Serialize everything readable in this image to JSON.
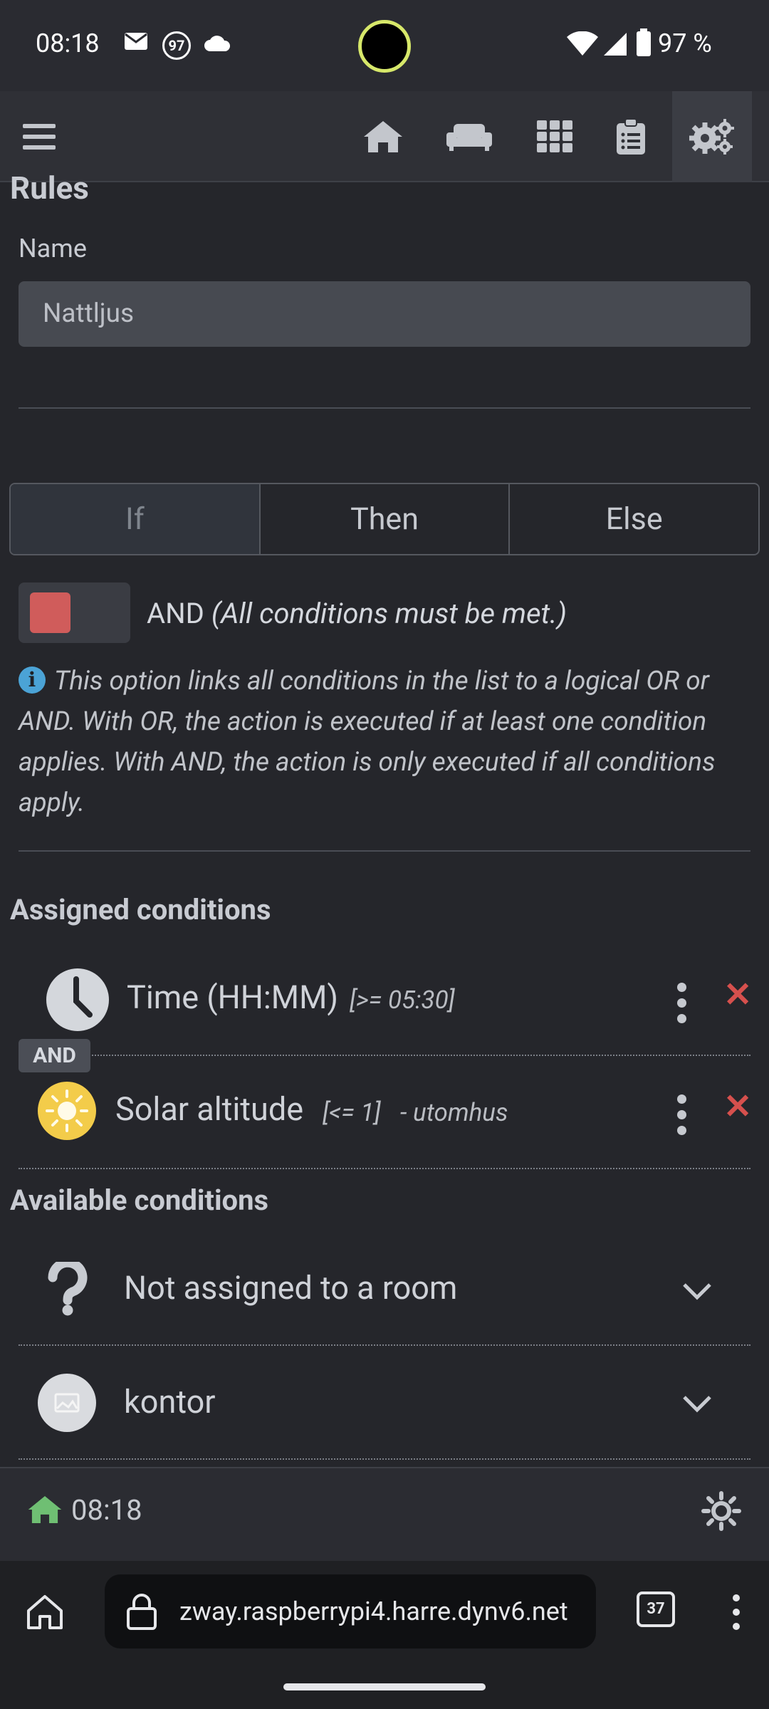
{
  "status_bar": {
    "time": "08:18",
    "notif_badge": "97",
    "battery": "97 %"
  },
  "nav": {
    "items": [
      "menu-icon",
      "home-icon",
      "sofa-icon",
      "grid-icon",
      "clipboard-icon",
      "settings-icon"
    ],
    "active": "settings-icon"
  },
  "page": {
    "title": "Rules",
    "name_label": "Name",
    "name_value": "Nattljus"
  },
  "tabs": [
    {
      "label": "If",
      "active": true
    },
    {
      "label": "Then",
      "active": false
    },
    {
      "label": "Else",
      "active": false
    }
  ],
  "logic": {
    "mode": "AND",
    "mode_desc": "(All conditions must be met.)",
    "info": "This option links all conditions in the list to a logical OR or AND. With OR, the action is executed if at least one condition applies. With AND, the action is only executed if all conditions apply.",
    "toggle_color": "#d05c5b"
  },
  "assigned": {
    "heading": "Assigned conditions",
    "connector": "AND",
    "items": [
      {
        "icon": "clock-icon",
        "title": "Time (HH:MM)",
        "detail": "[>= 05:30]",
        "room": ""
      },
      {
        "icon": "sun-icon",
        "title": "Solar altitude",
        "detail": "[<= 1]",
        "room": "- utomhus"
      }
    ]
  },
  "available": {
    "heading": "Available conditions",
    "items": [
      {
        "icon": "question-icon",
        "label": "Not assigned to a room"
      },
      {
        "icon": "room-photo-icon",
        "label": "kontor"
      }
    ]
  },
  "footer": {
    "time": "08:18"
  },
  "browser": {
    "url": "zway.raspberrypi4.harre.dynv6.net",
    "tab_count": "37"
  },
  "colors": {
    "accent_red": "#d6504d",
    "info_blue": "#4ba3d6",
    "sun_yellow": "#f3cc4a",
    "home_green": "#6fbf73"
  }
}
